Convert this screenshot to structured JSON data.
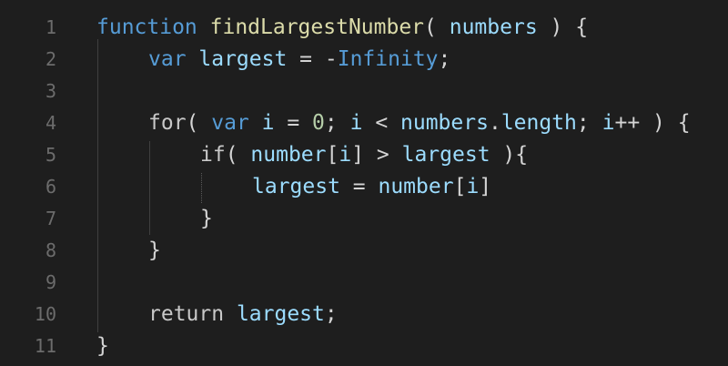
{
  "editor": {
    "lines": [
      {
        "number": "1",
        "tokens": [
          {
            "text": "function ",
            "kind": "kw"
          },
          {
            "text": "findLargestNumber",
            "kind": "fn"
          },
          {
            "text": "( ",
            "kind": "plain"
          },
          {
            "text": "numbers",
            "kind": "var"
          },
          {
            "text": " ) {",
            "kind": "plain"
          }
        ]
      },
      {
        "number": "2",
        "indent": 1,
        "tokens": [
          {
            "text": "var ",
            "kind": "kw"
          },
          {
            "text": "largest",
            "kind": "var"
          },
          {
            "text": " = ",
            "kind": "plain"
          },
          {
            "text": "-",
            "kind": "plain"
          },
          {
            "text": "Infinity",
            "kind": "kw"
          },
          {
            "text": ";",
            "kind": "plain"
          }
        ]
      },
      {
        "number": "3",
        "indent": 1,
        "tokens": []
      },
      {
        "number": "4",
        "indent": 1,
        "tokens": [
          {
            "text": "for",
            "kind": "ctrl2"
          },
          {
            "text": "( ",
            "kind": "plain"
          },
          {
            "text": "var ",
            "kind": "kw"
          },
          {
            "text": "i",
            "kind": "var"
          },
          {
            "text": " = ",
            "kind": "plain"
          },
          {
            "text": "0",
            "kind": "num"
          },
          {
            "text": "; ",
            "kind": "plain"
          },
          {
            "text": "i",
            "kind": "var"
          },
          {
            "text": " < ",
            "kind": "plain"
          },
          {
            "text": "numbers",
            "kind": "var"
          },
          {
            "text": ".",
            "kind": "plain"
          },
          {
            "text": "length",
            "kind": "var"
          },
          {
            "text": "; ",
            "kind": "plain"
          },
          {
            "text": "i",
            "kind": "var"
          },
          {
            "text": "++ ) {",
            "kind": "plain"
          }
        ]
      },
      {
        "number": "5",
        "indent": 2,
        "tokens": [
          {
            "text": "if",
            "kind": "ctrl2"
          },
          {
            "text": "( ",
            "kind": "plain"
          },
          {
            "text": "number",
            "kind": "var"
          },
          {
            "text": "[",
            "kind": "plain"
          },
          {
            "text": "i",
            "kind": "var"
          },
          {
            "text": "] > ",
            "kind": "plain"
          },
          {
            "text": "largest",
            "kind": "var"
          },
          {
            "text": " ){",
            "kind": "plain"
          }
        ]
      },
      {
        "number": "6",
        "indent": 3,
        "tokens": [
          {
            "text": "largest",
            "kind": "var"
          },
          {
            "text": " = ",
            "kind": "plain"
          },
          {
            "text": "number",
            "kind": "var"
          },
          {
            "text": "[",
            "kind": "plain"
          },
          {
            "text": "i",
            "kind": "var"
          },
          {
            "text": "]",
            "kind": "plain"
          }
        ]
      },
      {
        "number": "7",
        "indent": 2,
        "tokens": [
          {
            "text": "}",
            "kind": "plain"
          }
        ]
      },
      {
        "number": "8",
        "indent": 1,
        "tokens": [
          {
            "text": "}",
            "kind": "plain"
          }
        ]
      },
      {
        "number": "9",
        "indent": 1,
        "tokens": []
      },
      {
        "number": "10",
        "indent": 1,
        "tokens": [
          {
            "text": "return ",
            "kind": "ctrl2"
          },
          {
            "text": "largest",
            "kind": "var"
          },
          {
            "text": ";",
            "kind": "plain"
          }
        ]
      },
      {
        "number": "11",
        "tokens": [
          {
            "text": "}",
            "kind": "plain"
          }
        ]
      }
    ],
    "colors": {
      "background": "#1e1e1e",
      "line_number": "#6c6c6c",
      "keyword": "#569cd6",
      "variable": "#9cdcfe",
      "function": "#dcdcaa",
      "number": "#b5cea8",
      "text": "#d4d4d4"
    }
  }
}
